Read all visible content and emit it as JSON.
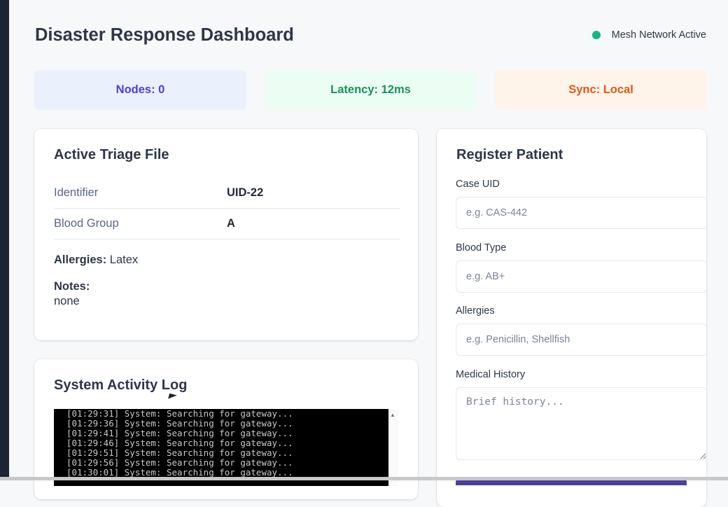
{
  "header": {
    "title": "Disaster Response Dashboard",
    "network_status": "Mesh Network Active"
  },
  "stats": {
    "nodes": "Nodes: 0",
    "latency": "Latency: 12ms",
    "sync": "Sync: Local"
  },
  "triage": {
    "title": "Active Triage File",
    "rows": [
      {
        "label": "Identifier",
        "value": "UID-22"
      },
      {
        "label": "Blood Group",
        "value": "A"
      }
    ],
    "allergies_label": "Allergies:",
    "allergies_value": "Latex",
    "notes_label": "Notes:",
    "notes_value": "none"
  },
  "log": {
    "title": "System Activity Log",
    "lines": [
      "[01:29:31] System: Searching for gateway...",
      "[01:29:36] System: Searching for gateway...",
      "[01:29:41] System: Searching for gateway...",
      "[01:29:46] System: Searching for gateway...",
      "[01:29:51] System: Searching for gateway...",
      "[01:29:56] System: Searching for gateway...",
      "[01:30:01] System: Searching for gateway..."
    ]
  },
  "register": {
    "title": "Register Patient",
    "case_uid_label": "Case UID",
    "case_uid_placeholder": "e.g. CAS-442",
    "blood_type_label": "Blood Type",
    "blood_type_placeholder": "e.g. AB+",
    "allergies_label": "Allergies",
    "allergies_placeholder": "e.g. Penicillin, Shellfish",
    "history_label": "Medical History",
    "history_placeholder": "Brief history..."
  },
  "colors": {
    "status_dot": "#10b981",
    "nodes": "#4c3fd1",
    "latency": "#17925a",
    "sync": "#e05a13"
  }
}
